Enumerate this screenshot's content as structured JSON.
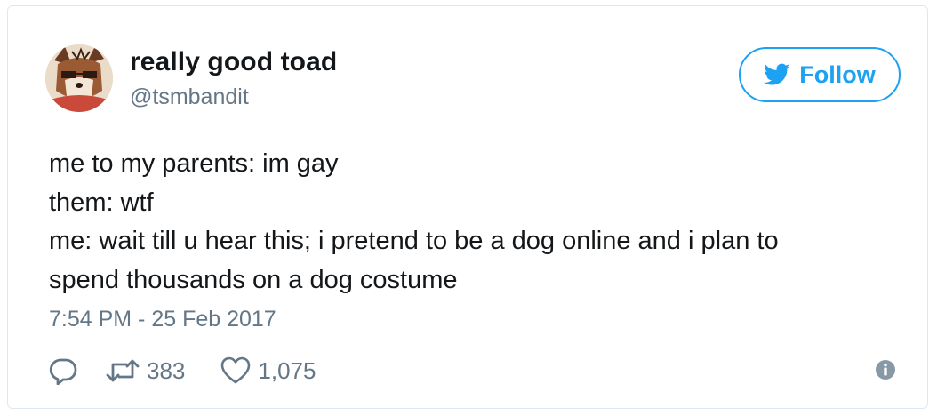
{
  "user": {
    "display_name": "really good toad",
    "handle": "@tsmbandit",
    "avatar_icon": "dog-fursona-avatar"
  },
  "follow_button": {
    "label": "Follow",
    "icon": "twitter-bird-icon",
    "color": "#1da1f2"
  },
  "tweet": {
    "lines": [
      "me to my parents: im gay",
      "them: wtf",
      "me: wait till u hear this; i pretend to be a dog online and i plan to",
      "spend thousands on a dog costume"
    ],
    "timestamp": "7:54 PM - 25 Feb 2017"
  },
  "actions": {
    "reply_icon": "reply-icon",
    "retweet_icon": "retweet-icon",
    "retweet_count": "383",
    "like_icon": "heart-icon",
    "like_count": "1,075",
    "info_icon": "info-icon"
  },
  "colors": {
    "text": "#14171a",
    "muted": "#657786",
    "accent": "#1da1f2",
    "border": "#e1e8ed"
  }
}
